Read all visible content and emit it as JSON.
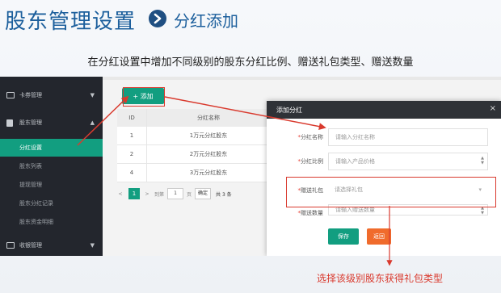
{
  "header": {
    "title": "股东管理设置",
    "subtitle": "分红添加",
    "description": "在分红设置中增加不同级别的股东分红比例、赠送礼包类型、赠送数量"
  },
  "sidebar": {
    "groups": [
      {
        "label": "卡券管理",
        "icon": "card-icon",
        "arrow": "▼"
      },
      {
        "label": "股东管理",
        "icon": "user-icon",
        "arrow": "▲"
      },
      {
        "label": "收银管理",
        "icon": "check-icon",
        "arrow": "▼"
      }
    ],
    "sub_items": [
      {
        "label": "分红设置",
        "active": true
      },
      {
        "label": "股东列表",
        "active": false
      },
      {
        "label": "提现管理",
        "active": false
      },
      {
        "label": "股东分红记录",
        "active": false
      },
      {
        "label": "股东资金明细",
        "active": false
      }
    ]
  },
  "toolbar": {
    "add_label": "+ 添加"
  },
  "table": {
    "columns": [
      "ID",
      "分红名称"
    ],
    "rows": [
      {
        "id": "1",
        "name": "1万元分红股东"
      },
      {
        "id": "2",
        "name": "2万元分红股东"
      },
      {
        "id": "4",
        "name": "3万元分红股东"
      }
    ]
  },
  "pagination": {
    "prev": "<",
    "current": "1",
    "next": ">",
    "goto_label": "到第",
    "page_input": "1",
    "page_unit": "页",
    "confirm": "确定",
    "total": "共 3 条"
  },
  "modal": {
    "title": "添加分红",
    "close": "×",
    "fields": [
      {
        "label": "分红名称",
        "placeholder": "请输入分红名称",
        "type": "text"
      },
      {
        "label": "分红比例",
        "placeholder": "请输入产品价格",
        "type": "number"
      },
      {
        "label": "赠送礼包",
        "placeholder": "请选择礼包",
        "type": "select"
      },
      {
        "label": "赠送数量",
        "placeholder": "请输入赠送数量",
        "type": "number"
      }
    ],
    "save_label": "保存",
    "back_label": "返回"
  },
  "annotation": {
    "caption": "选择该级别股东获得礼包类型",
    "color": "#d93a2e"
  },
  "colors": {
    "accent": "#129e80",
    "title_blue": "#1c5f9c",
    "back_orange": "#f06b2c",
    "sidebar_dark": "#23262d"
  }
}
